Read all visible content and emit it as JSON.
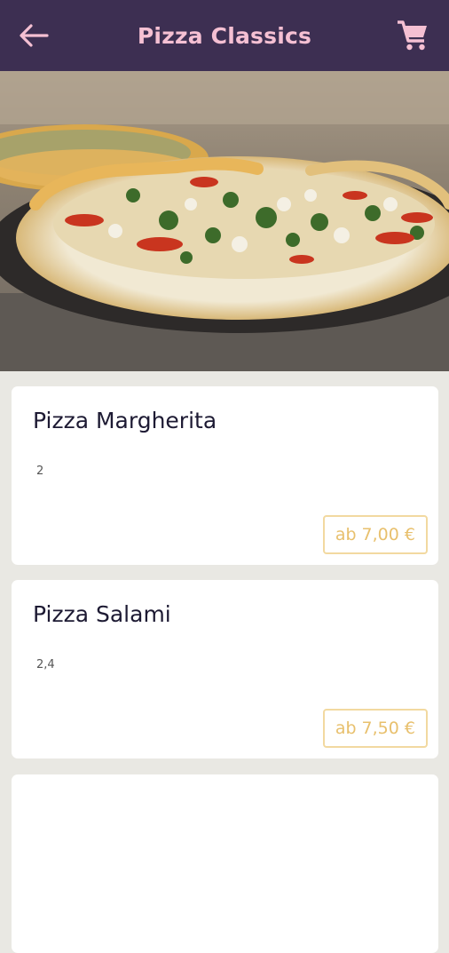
{
  "header": {
    "title": "Pizza Classics"
  },
  "icons": {
    "back": "arrow-left-icon",
    "cart": "cart-icon"
  },
  "colors": {
    "header_bg": "#3d2f52",
    "title": "#f5c0d3",
    "price_accent": "#e8c06d"
  },
  "items": [
    {
      "name": "Pizza Margherita",
      "info": "2",
      "price": "ab 7,00 €"
    },
    {
      "name": "Pizza Salami",
      "info": "2,4",
      "price": "ab 7,50 €"
    }
  ]
}
